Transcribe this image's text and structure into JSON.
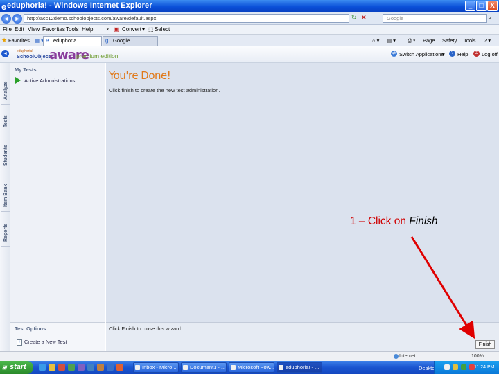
{
  "window": {
    "title": "eduphoria! - Windows Internet Explorer",
    "minimize": "_",
    "maximize": "□",
    "close": "X"
  },
  "address_bar": {
    "url": "http://acc12demo.schoolobjects.com/aware/default.aspx",
    "search_placeholder": "Google"
  },
  "menu": [
    "File",
    "Edit",
    "View",
    "Favorites",
    "Tools",
    "Help"
  ],
  "pdf_toolbar": {
    "convert": "Convert",
    "select": "Select"
  },
  "favorites": {
    "label": "Favorites",
    "tabs": [
      {
        "label": "eduphoria"
      },
      {
        "label": "Google"
      }
    ],
    "tools": [
      "Page",
      "Safety",
      "Tools"
    ]
  },
  "app": {
    "brand_small": "SchoolObjects",
    "brand_tag": "eduphoria!",
    "brand": "aware",
    "edition": "premium edition",
    "switch_apps": "Switch Applications",
    "help": "Help",
    "logoff": "Log off"
  },
  "vertical_tabs": [
    "Analyze",
    "Tests",
    "Students",
    "Item Bank",
    "Reports"
  ],
  "sidebar": {
    "heading": "My Tests",
    "item": "Active Administrations",
    "options_heading": "Test Options",
    "create_test": "Create a New Test"
  },
  "main": {
    "title": "You're Done!",
    "instruction": "Click finish to create the new test administration.",
    "footer_text": "Click Finish to close this wizard.",
    "finish_button": "Finish"
  },
  "annotation": {
    "prefix": "1 – Click on",
    "emphasis": "Finish",
    "color": "#d00000"
  },
  "status_bar": {
    "zone": "Internet",
    "zoom": "100%"
  },
  "taskbar": {
    "start": "start",
    "tasks": [
      {
        "label": "Inbox - Micro..."
      },
      {
        "label": "Document1 - ..."
      },
      {
        "label": "Microsoft Pow..."
      },
      {
        "label": "eduphoria! - ..."
      }
    ],
    "desktop": "Desktop",
    "clock": "11:24 PM"
  }
}
